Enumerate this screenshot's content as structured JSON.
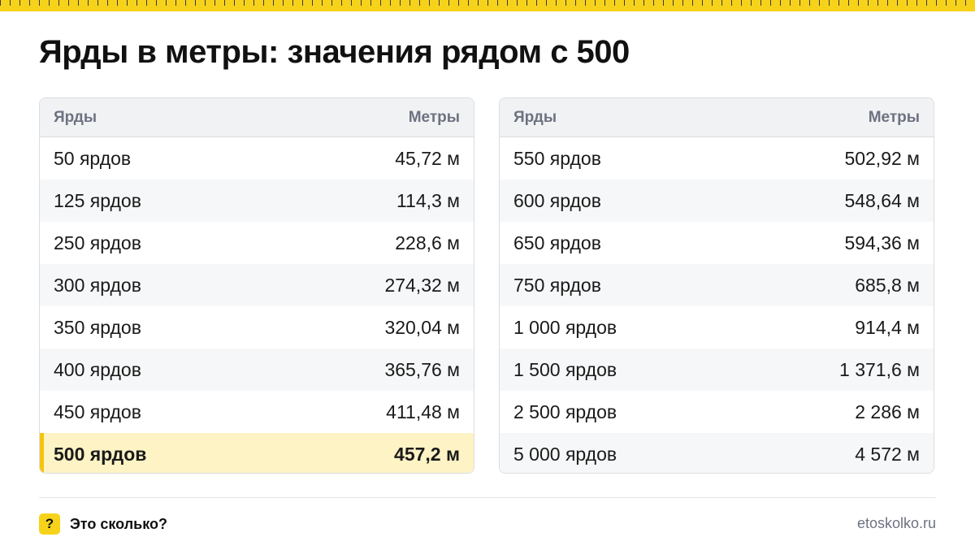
{
  "title": "Ярды в метры: значения рядом с 500",
  "tables": [
    {
      "header": {
        "col1": "Ярды",
        "col2": "Метры"
      },
      "rows": [
        {
          "yards": "50 ярдов",
          "meters": "45,72 м"
        },
        {
          "yards": "125 ярдов",
          "meters": "114,3 м"
        },
        {
          "yards": "250 ярдов",
          "meters": "228,6 м"
        },
        {
          "yards": "300 ярдов",
          "meters": "274,32 м"
        },
        {
          "yards": "350 ярдов",
          "meters": "320,04 м"
        },
        {
          "yards": "400 ярдов",
          "meters": "365,76 м"
        },
        {
          "yards": "450 ярдов",
          "meters": "411,48 м"
        },
        {
          "yards": "500 ярдов",
          "meters": "457,2 м",
          "highlight": true
        }
      ]
    },
    {
      "header": {
        "col1": "Ярды",
        "col2": "Метры"
      },
      "rows": [
        {
          "yards": "550 ярдов",
          "meters": "502,92 м"
        },
        {
          "yards": "600 ярдов",
          "meters": "548,64 м"
        },
        {
          "yards": "650 ярдов",
          "meters": "594,36 м"
        },
        {
          "yards": "750 ярдов",
          "meters": "685,8 м"
        },
        {
          "yards": "1 000 ярдов",
          "meters": "914,4 м"
        },
        {
          "yards": "1 500 ярдов",
          "meters": "1 371,6 м"
        },
        {
          "yards": "2 500 ярдов",
          "meters": "2 286 м"
        },
        {
          "yards": "5 000 ярдов",
          "meters": "4 572 м"
        }
      ]
    }
  ],
  "footer": {
    "brand_icon": "?",
    "brand_name": "Это сколько?",
    "site": "etoskolko.ru"
  },
  "colors": {
    "accent": "#f7d21a",
    "highlight_row": "#fdf3c4"
  },
  "icons": {
    "brand": "question-mark-icon",
    "ruler": "ruler-strip"
  }
}
